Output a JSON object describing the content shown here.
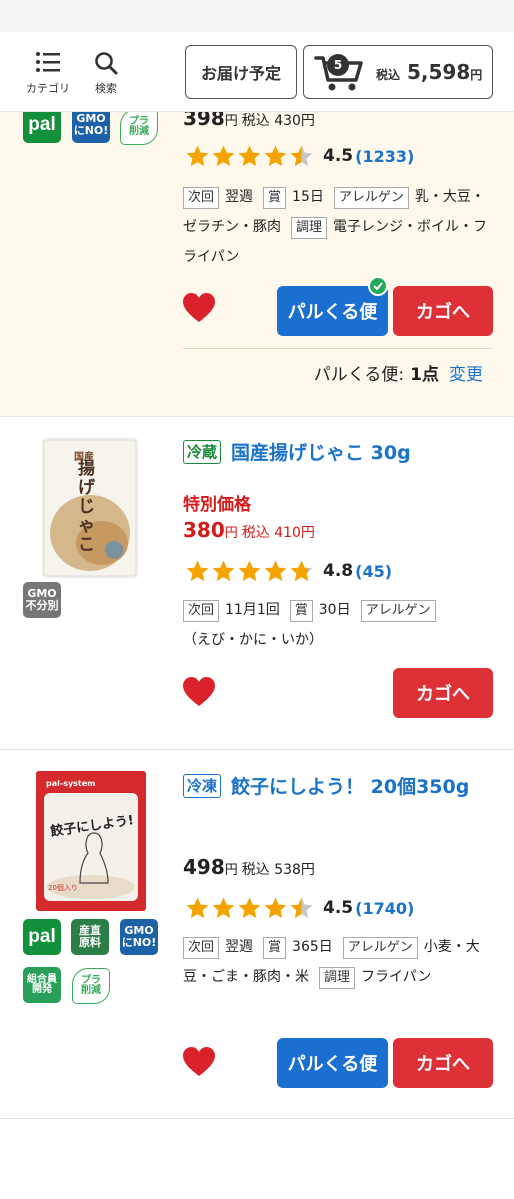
{
  "header": {
    "category_label": "カテゴリ",
    "search_label": "検索",
    "delivery_label": "お届け予定",
    "cart_count": "5",
    "cart_tax_label": "税込",
    "cart_total": "5,598",
    "cart_yen": "円"
  },
  "products": [
    {
      "badges": [
        "pal",
        "GMO\nにNO!",
        "プラ\n削減"
      ],
      "price": "398",
      "yen": "円",
      "tax_price": "税込 430円",
      "rating": 4.5,
      "rating_text": "4.5",
      "review_count": "(1233)",
      "next_label": "次回",
      "next_value": "翌週",
      "shelf_label": "賞",
      "shelf_value": "15日",
      "allergen_label": "アレルゲン",
      "allergen_value": "乳・大豆・ゼラチン・豚肉",
      "cook_label": "調理",
      "cook_value": "電子レンジ・ボイル・フライパン",
      "pal_button": "パルくる便",
      "cart_button": "カゴへ",
      "pal_status_label": "パルくる便:",
      "pal_status_value": "1点",
      "pal_status_change": "変更"
    },
    {
      "badges": [
        "GMO\n不分別"
      ],
      "temp_tag": "冷蔵",
      "name": "国産揚げじゃこ 30g",
      "special": "特別価格",
      "price": "380",
      "yen": "円",
      "tax_price": "税込 410円",
      "rating": 4.8,
      "rating_text": "4.8",
      "review_count": "(45)",
      "next_label": "次回",
      "next_value": "11月1回",
      "shelf_label": "賞",
      "shelf_value": "30日",
      "allergen_label": "アレルゲン",
      "allergen_value": "（えび・かに・いか）",
      "cart_button": "カゴへ",
      "image_text": "揚げじゃこ",
      "image_sub": "国産"
    },
    {
      "badges": [
        "pal",
        "産直\n原料",
        "GMO\nにNO!",
        "組合員\n開発",
        "プラ\n削減"
      ],
      "temp_tag": "冷凍",
      "name": "餃子にしよう！ 20個350g",
      "price": "498",
      "yen": "円",
      "tax_price": "税込 538円",
      "rating": 4.5,
      "rating_text": "4.5",
      "review_count": "(1740)",
      "next_label": "次回",
      "next_value": "翌週",
      "shelf_label": "賞",
      "shelf_value": "365日",
      "allergen_label": "アレルゲン",
      "allergen_value": "小麦・大豆・ごま・豚肉・米",
      "cook_label": "調理",
      "cook_value": "フライパン",
      "pal_button": "パルくる便",
      "cart_button": "カゴへ",
      "image_text": "餃子にしよう!",
      "image_brand": "pal-system",
      "image_sub": "20個入り"
    }
  ],
  "colors": {
    "accent_blue": "#1a73c9",
    "cart_red": "#dd3137",
    "pal_blue": "#1a6fd0",
    "star": "#f4a300",
    "highlight_bg": "#fef9ec"
  }
}
